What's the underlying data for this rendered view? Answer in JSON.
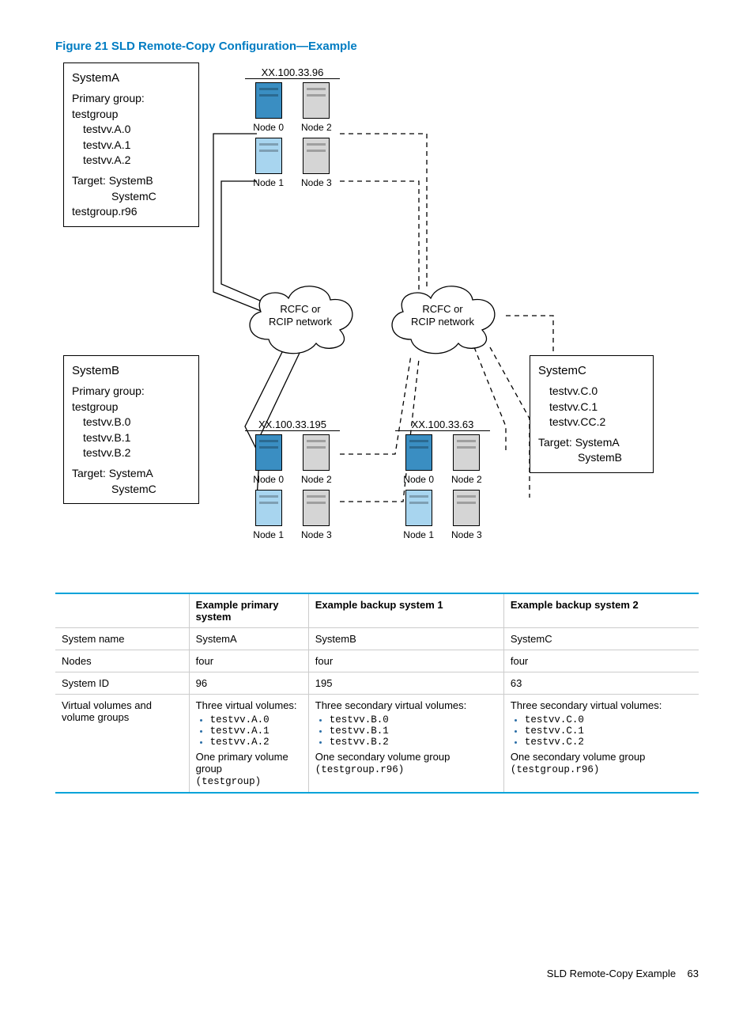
{
  "figure_title": "Figure 21 SLD Remote-Copy Configuration—Example",
  "systemA": {
    "name": "SystemA",
    "group_label": "Primary group:",
    "group_name": "testgroup",
    "vols": [
      "testvv.A.0",
      "testvv.A.1",
      "testvv.A.2"
    ],
    "target_label": "Target: SystemB",
    "target2": "SystemC",
    "extra": "testgroup.r96"
  },
  "systemB": {
    "name": "SystemB",
    "group_label": "Primary group:",
    "group_name": "testgroup",
    "vols": [
      "testvv.B.0",
      "testvv.B.1",
      "testvv.B.2"
    ],
    "target_label": "Target: SystemA",
    "target2": "SystemC"
  },
  "systemC": {
    "name": "SystemC",
    "vols": [
      "testvv.C.0",
      "testvv.C.1",
      "testvv.CC.2"
    ],
    "target_label": "Target: SystemA",
    "target2": "SystemB"
  },
  "clusters": {
    "top": {
      "ip": "XX.100.33.96",
      "nodes": [
        "Node 0",
        "Node 2",
        "Node 1",
        "Node 3"
      ]
    },
    "left": {
      "ip": "XX.100.33.195",
      "nodes": [
        "Node 0",
        "Node 2",
        "Node 1",
        "Node 3"
      ]
    },
    "right": {
      "ip": "XX.100.33.63",
      "nodes": [
        "Node 0",
        "Node 2",
        "Node 1",
        "Node 3"
      ]
    }
  },
  "cloud_text1": "RCFC or",
  "cloud_text2": "RCIP network",
  "table": {
    "headers": [
      "",
      "Example primary system",
      "Example backup system 1",
      "Example backup system 2"
    ],
    "rows": [
      {
        "label": "System name",
        "c1": "SystemA",
        "c2": "SystemB",
        "c3": "SystemC"
      },
      {
        "label": "Nodes",
        "c1": "four",
        "c2": "four",
        "c3": "four"
      },
      {
        "label": "System ID",
        "c1": "96",
        "c2": "195",
        "c3": "63"
      }
    ],
    "vol_row_label": "Virtual volumes and volume groups",
    "vol_primary": {
      "intro": "Three virtual volumes:",
      "items": [
        "testvv.A.0",
        "testvv.A.1",
        "testvv.A.2"
      ],
      "outro1": "One primary volume group",
      "outro2": "(testgroup)"
    },
    "vol_b1": {
      "intro": "Three secondary virtual volumes:",
      "items": [
        "testvv.B.0",
        "testvv.B.1",
        "testvv.B.2"
      ],
      "outro1": "One secondary volume group ",
      "outro2": "(testgroup.r96)"
    },
    "vol_b2": {
      "intro": "Three secondary virtual volumes:",
      "items": [
        "testvv.C.0",
        "testvv.C.1",
        "testvv.C.2"
      ],
      "outro1": "One secondary volume group ",
      "outro2": "(testgroup.r96)"
    }
  },
  "footer": {
    "title": "SLD Remote-Copy Example",
    "page": "63"
  }
}
